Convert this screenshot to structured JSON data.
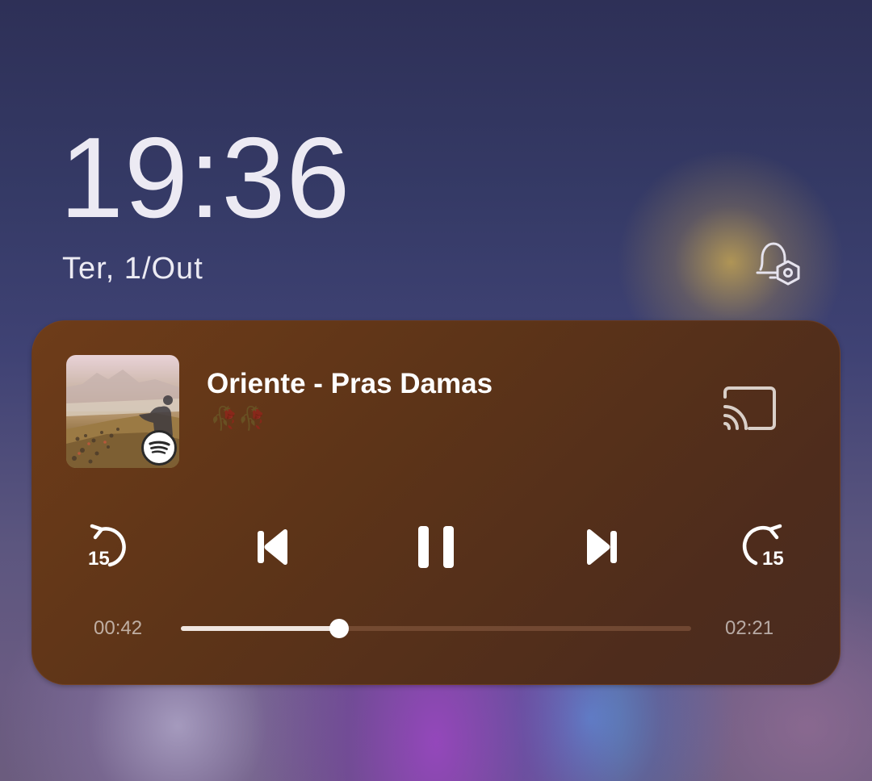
{
  "lockscreen": {
    "time": "19:36",
    "date": "Ter, 1/Out",
    "notification_settings_icon": "bell-settings-icon"
  },
  "media_player": {
    "track_title": "Oriente - Pras Damas",
    "artist": "🥀🥀",
    "app_badge_icon": "spotify-icon",
    "cast_icon": "cast-icon",
    "controls": {
      "rewind_15": "15",
      "previous_icon": "skip-previous-icon",
      "play_pause_icon": "pause-icon",
      "next_icon": "skip-next-icon",
      "forward_15": "15"
    },
    "elapsed": "00:42",
    "duration": "02:21",
    "progress": 0.31
  },
  "colors": {
    "player_background": "#5d3418",
    "accent_text": "#ffffff",
    "seek_fill": "#f0e6e0"
  }
}
